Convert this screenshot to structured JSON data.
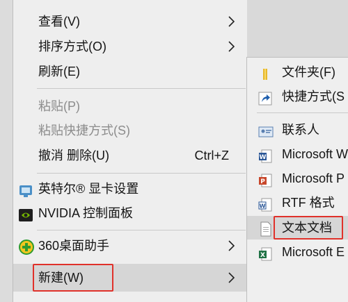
{
  "context_menu": {
    "items": [
      {
        "label": "查看(V)",
        "submenu": true,
        "disabled": false
      },
      {
        "label": "排序方式(O)",
        "submenu": true,
        "disabled": false
      },
      {
        "label": "刷新(E)",
        "submenu": false,
        "disabled": false
      },
      {
        "label": "粘贴(P)",
        "submenu": false,
        "disabled": true
      },
      {
        "label": "粘贴快捷方式(S)",
        "submenu": false,
        "disabled": true
      },
      {
        "label": "撤消 删除(U)",
        "shortcut": "Ctrl+Z",
        "submenu": false,
        "disabled": false
      },
      {
        "label": "英特尔® 显卡设置",
        "icon": "intel-graphics-icon"
      },
      {
        "label": "NVIDIA 控制面板",
        "icon": "nvidia-icon"
      },
      {
        "label": "360桌面助手",
        "icon": "360-desktop-icon",
        "submenu": true
      },
      {
        "label": "新建(W)",
        "submenu": true,
        "highlighted": true
      }
    ]
  },
  "new_submenu": {
    "items": [
      {
        "label": "文件夹(F)",
        "icon": "folder-icon"
      },
      {
        "label": "快捷方式(S",
        "icon": "shortcut-arrow-icon"
      },
      {
        "label": "联系人",
        "icon": "contact-card-icon"
      },
      {
        "label": "Microsoft W",
        "icon": "word-doc-icon"
      },
      {
        "label": "Microsoft P",
        "icon": "powerpoint-icon"
      },
      {
        "label": "RTF 格式",
        "icon": "rtf-doc-icon"
      },
      {
        "label": "文本文档",
        "icon": "text-document-icon",
        "highlighted": true
      },
      {
        "label": "Microsoft E",
        "icon": "excel-icon"
      }
    ]
  },
  "colors": {
    "highlight_box": "#e0312a",
    "menu_bg": "#eeeeee",
    "disabled_text": "#8c8c8c"
  }
}
